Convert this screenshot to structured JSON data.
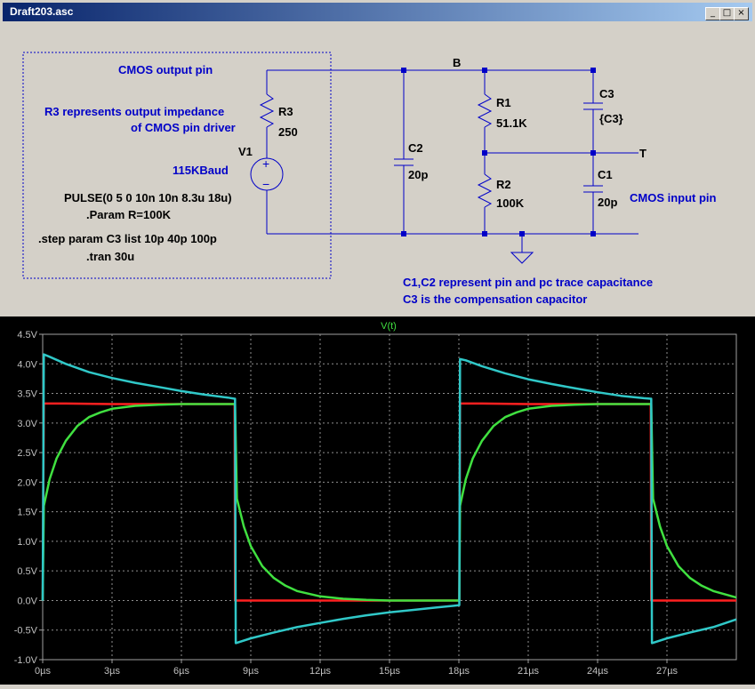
{
  "window": {
    "title": "Draft203.asc"
  },
  "titlebar_buttons": {
    "minimize": "_",
    "maximize": "□",
    "close": "×"
  },
  "schematic": {
    "group_label": "CMOS output pin",
    "note_r3_line1": "R3 represents output impedance",
    "note_r3_line2": "of CMOS pin driver",
    "v1_name": "V1",
    "v1_baud": "115KBaud",
    "v1_sign_plus": "+",
    "v1_sign_minus": "−",
    "pulse": "PULSE(0 5 0 10n 10n 8.3u 18u)",
    "param": ".Param R=100K",
    "step": ".step param C3 list 10p 40p 100p",
    "tran": ".tran 30u",
    "r3_name": "R3",
    "r3_value": "250",
    "c2_name": "C2",
    "c2_value": "20p",
    "r1_name": "R1",
    "r1_value": "51.1K",
    "r2_name": "R2",
    "r2_value": "100K",
    "c3_name": "C3",
    "c3_value": "{C3}",
    "c1_name": "C1",
    "c1_value": "20p",
    "net_b": "B",
    "net_t": "T",
    "input_pin": "CMOS input pin",
    "note_c1c2": "C1,C2 represent pin and pc trace capacitance",
    "note_c3": "C3 is the compensation capacitor"
  },
  "colors": {
    "schematic_text": "#0000c8",
    "trace_red": "#ff2020",
    "trace_green": "#40e040",
    "trace_cyan": "#30c8c8",
    "plot_bg": "#000000"
  },
  "chart_data": {
    "type": "line",
    "title": "V(t)",
    "xlabel": "",
    "ylabel": "",
    "x_ticks": [
      "0µs",
      "3µs",
      "6µs",
      "9µs",
      "12µs",
      "15µs",
      "18µs",
      "21µs",
      "24µs",
      "27µs"
    ],
    "y_ticks": [
      "4.5V",
      "4.0V",
      "3.5V",
      "3.0V",
      "2.5V",
      "2.0V",
      "1.5V",
      "1.0V",
      "0.5V",
      "0.0V",
      "-0.5V",
      "-1.0V"
    ],
    "xlim": [
      0,
      30
    ],
    "ylim": [
      -1.0,
      4.5
    ],
    "grid": true,
    "series": [
      {
        "color": "#ff2020",
        "x": [
          0,
          0.05,
          1,
          3,
          5,
          7,
          8.3,
          8.32,
          9,
          12,
          15,
          17,
          18,
          18.02,
          18.05,
          19,
          21,
          23,
          26.3,
          26.32,
          27,
          30
        ],
        "values": [
          0,
          3.33,
          3.33,
          3.32,
          3.32,
          3.32,
          3.32,
          0,
          0,
          0,
          0,
          0,
          0,
          0,
          3.33,
          3.33,
          3.32,
          3.32,
          3.32,
          0,
          0,
          0
        ]
      },
      {
        "color": "#40e040",
        "x": [
          0,
          0.05,
          0.3,
          0.6,
          1,
          1.5,
          2,
          2.5,
          3,
          4,
          5,
          6,
          7,
          8.3,
          8.32,
          8.4,
          8.7,
          9,
          9.5,
          10,
          10.5,
          11,
          12,
          13,
          14,
          15,
          17,
          18,
          18.02,
          18.05,
          18.3,
          18.6,
          19,
          19.5,
          20,
          20.5,
          21,
          22,
          23,
          24,
          26.3,
          26.32,
          26.4,
          26.7,
          27,
          27.5,
          28,
          28.5,
          29,
          30
        ],
        "values": [
          0,
          1.6,
          2.05,
          2.4,
          2.7,
          2.95,
          3.1,
          3.18,
          3.24,
          3.29,
          3.31,
          3.32,
          3.32,
          3.32,
          3.32,
          1.72,
          1.25,
          0.92,
          0.58,
          0.38,
          0.25,
          0.16,
          0.07,
          0.03,
          0.01,
          0.0,
          0.0,
          0.0,
          0.0,
          1.6,
          2.05,
          2.4,
          2.7,
          2.95,
          3.1,
          3.18,
          3.24,
          3.29,
          3.31,
          3.32,
          3.32,
          3.32,
          1.72,
          1.25,
          0.92,
          0.58,
          0.38,
          0.25,
          0.16,
          0.05
        ]
      },
      {
        "color": "#30c8c8",
        "x": [
          0,
          0.05,
          0.3,
          1,
          2,
          3,
          4,
          5,
          6,
          7,
          8,
          8.3,
          8.32,
          8.35,
          9,
          10,
          11,
          12,
          13,
          14,
          15,
          16,
          17,
          18,
          18.02,
          18.05,
          18.3,
          19,
          20,
          21,
          22,
          23,
          24,
          25,
          26,
          26.3,
          26.32,
          26.35,
          27,
          28,
          29,
          30
        ],
        "values": [
          0,
          4.16,
          4.12,
          4.0,
          3.86,
          3.76,
          3.68,
          3.61,
          3.54,
          3.48,
          3.43,
          3.41,
          3.41,
          -0.72,
          -0.64,
          -0.54,
          -0.45,
          -0.38,
          -0.31,
          -0.25,
          -0.2,
          -0.16,
          -0.12,
          -0.08,
          -0.08,
          4.08,
          4.06,
          3.96,
          3.84,
          3.74,
          3.66,
          3.59,
          3.52,
          3.46,
          3.42,
          3.41,
          3.41,
          -0.72,
          -0.64,
          -0.54,
          -0.45,
          -0.32
        ]
      }
    ]
  }
}
